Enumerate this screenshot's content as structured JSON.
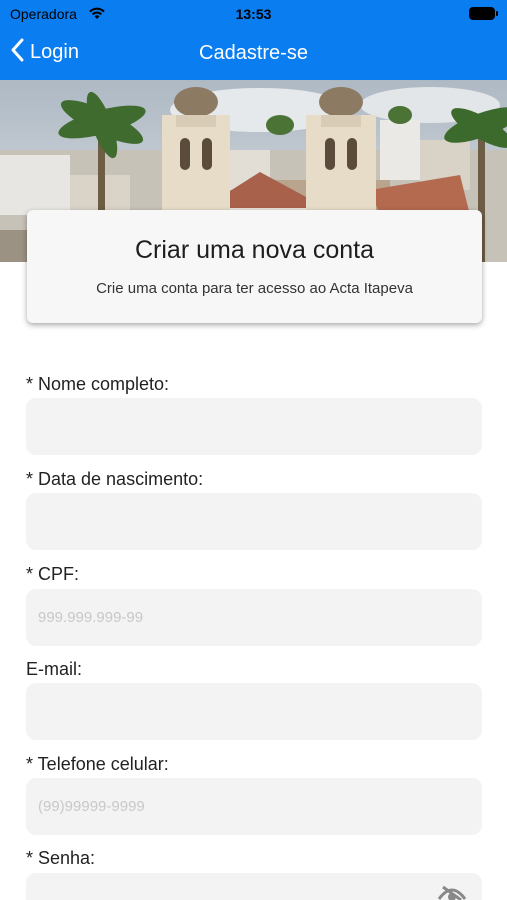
{
  "status": {
    "carrier": "Operadora",
    "time": "13:53"
  },
  "nav": {
    "back_label": "Login",
    "title": "Cadastre-se"
  },
  "card": {
    "title": "Criar uma nova conta",
    "subtitle": "Crie uma conta para ter acesso ao Acta Itapeva"
  },
  "form": {
    "name_label": "* Nome completo:",
    "birth_label": "* Data de nascimento:",
    "cpf_label": "* CPF:",
    "cpf_placeholder": "999.999.999-99",
    "email_label": "E-mail:",
    "phone_label": "* Telefone celular:",
    "phone_placeholder": "(99)99999-9999",
    "password_label": "* Senha:"
  },
  "colors": {
    "nav_bg": "#0a7df0",
    "field_bg": "#f3f3f3"
  }
}
